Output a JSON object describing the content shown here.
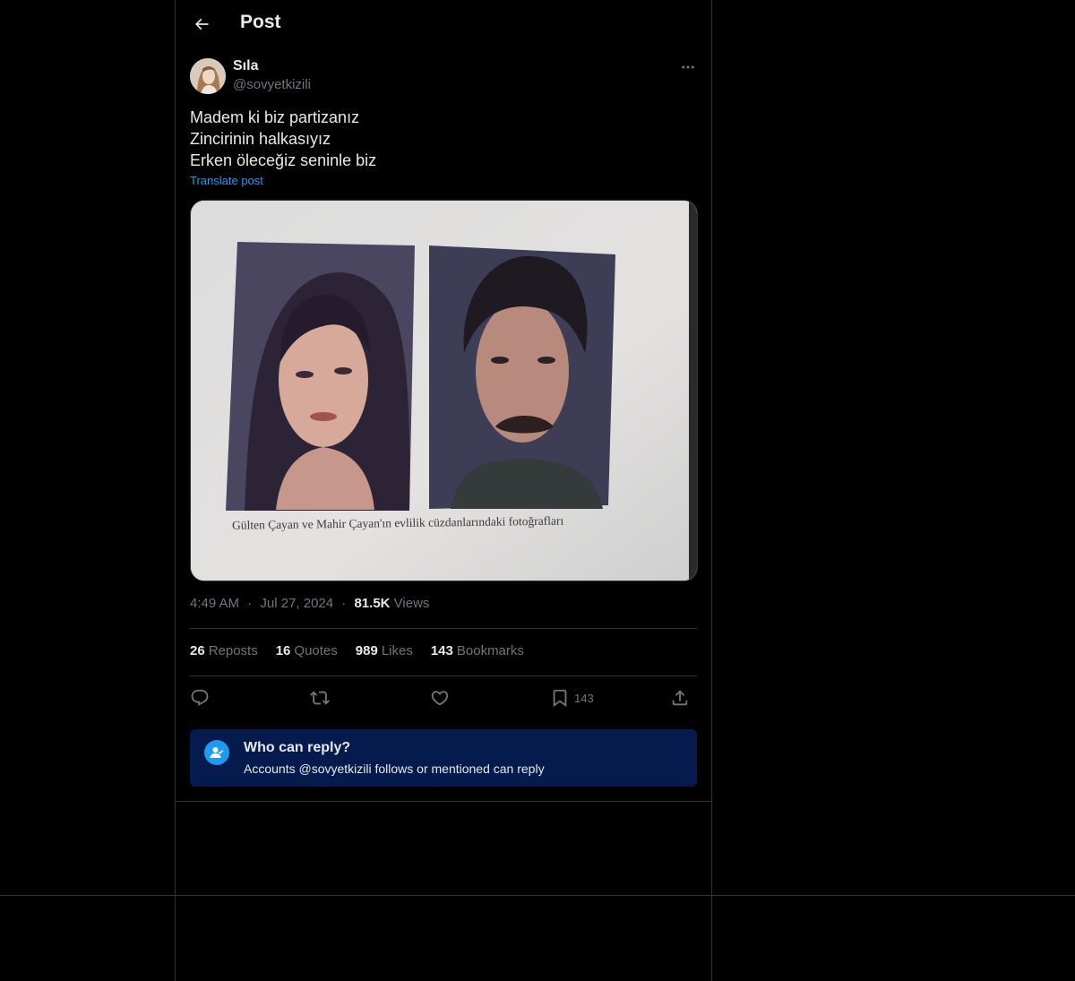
{
  "header": {
    "title": "Post",
    "back_icon": "arrow-left-icon"
  },
  "author": {
    "name": "Sıla",
    "handle": "@sovyetkizili"
  },
  "post": {
    "lines": [
      "Madem ki biz partizanız",
      "Zincirinin halkasıyız",
      "Erken öleceğiz seninle biz"
    ],
    "translate_label": "Translate post",
    "image_caption": "Gülten Çayan ve Mahir Çayan'ın evlilik cüzdanlarındaki fotoğrafları"
  },
  "meta": {
    "time": "4:49 AM",
    "date": "Jul 27, 2024",
    "sep": "·",
    "views_count": "81.5K",
    "views_label": "Views"
  },
  "stats": [
    {
      "count": "26",
      "label": "Reposts"
    },
    {
      "count": "16",
      "label": "Quotes"
    },
    {
      "count": "989",
      "label": "Likes"
    },
    {
      "count": "143",
      "label": "Bookmarks"
    }
  ],
  "actions": {
    "reply_icon": "reply-icon",
    "repost_icon": "repost-icon",
    "like_icon": "like-icon",
    "bookmark_icon": "bookmark-icon",
    "bookmark_count": "143",
    "share_icon": "share-icon"
  },
  "who_can_reply": {
    "title": "Who can reply?",
    "description": "Accounts @sovyetkizili follows or mentioned can reply"
  },
  "colors": {
    "background": "#000000",
    "text": "#e7e9ea",
    "muted": "#71767b",
    "accent": "#1d9bf0",
    "border": "#2f3336",
    "reply_box": "#051a4d"
  }
}
